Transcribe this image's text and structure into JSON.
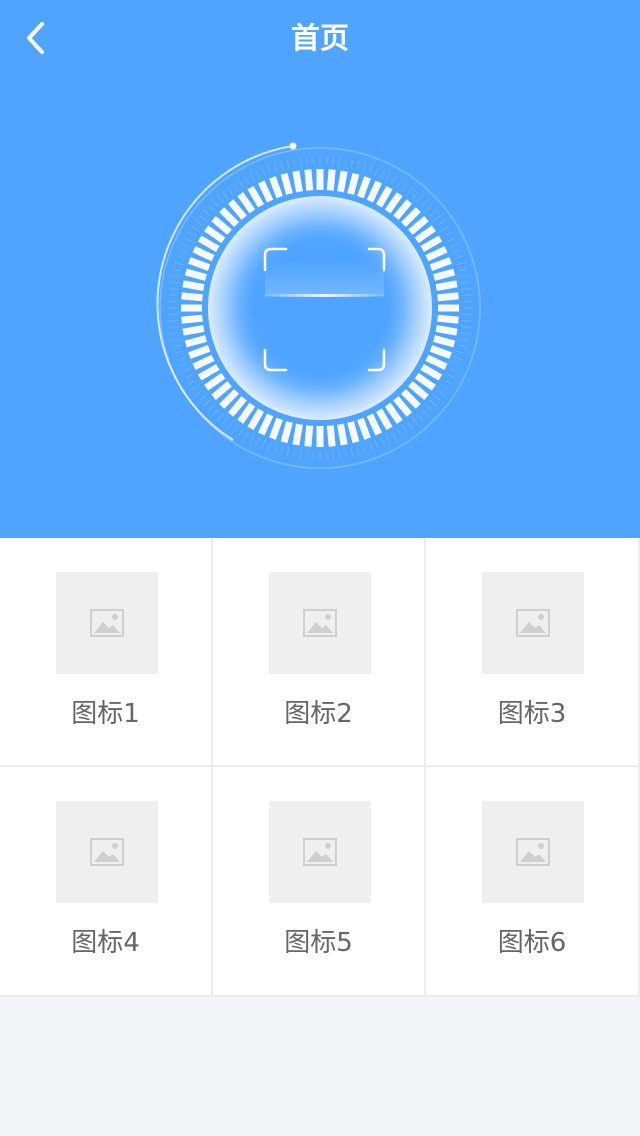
{
  "header": {
    "title": "首页",
    "back_icon": "chevron-left-icon"
  },
  "scanner": {
    "icon": "scan-frame-icon"
  },
  "colors": {
    "hero_background": "#4fa4ff",
    "grid_border": "#ececec",
    "thumb_background": "#efefef",
    "label_text": "#666666",
    "page_background": "#f3f4f8"
  },
  "grid": {
    "items": [
      {
        "label": "图标1",
        "icon": "image-placeholder-icon"
      },
      {
        "label": "图标2",
        "icon": "image-placeholder-icon"
      },
      {
        "label": "图标3",
        "icon": "image-placeholder-icon"
      },
      {
        "label": "图标4",
        "icon": "image-placeholder-icon"
      },
      {
        "label": "图标5",
        "icon": "image-placeholder-icon"
      },
      {
        "label": "图标6",
        "icon": "image-placeholder-icon"
      }
    ]
  }
}
